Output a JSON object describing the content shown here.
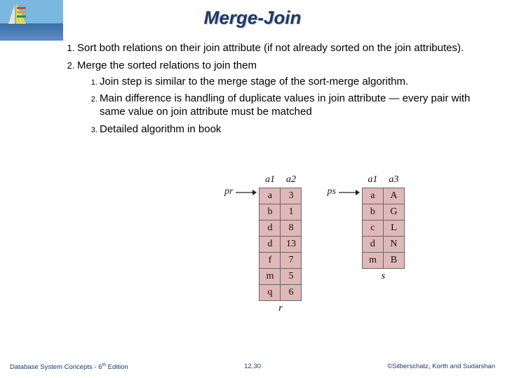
{
  "title": "Merge-Join",
  "bullets": {
    "b1": "Sort both relations on their join attribute (if not already sorted on the join attributes).",
    "b2": "Merge the sorted relations to join them",
    "b2_1": "Join step is similar to the merge stage of the sort-merge algorithm.",
    "b2_2": "Main difference is handling of duplicate values in join attribute — every pair with same value on join attribute must be matched",
    "b2_3": "Detailed algorithm in book"
  },
  "figure": {
    "r": {
      "ptr": "pr",
      "headers": [
        "a1",
        "a2"
      ],
      "rows": [
        [
          "a",
          "3"
        ],
        [
          "b",
          "1"
        ],
        [
          "d",
          "8"
        ],
        [
          "d",
          "13"
        ],
        [
          "f",
          "7"
        ],
        [
          "m",
          "5"
        ],
        [
          "q",
          "6"
        ]
      ],
      "name": "r"
    },
    "s": {
      "ptr": "ps",
      "headers": [
        "a1",
        "a3"
      ],
      "rows": [
        [
          "a",
          "A"
        ],
        [
          "b",
          "G"
        ],
        [
          "c",
          "L"
        ],
        [
          "d",
          "N"
        ],
        [
          "m",
          "B"
        ]
      ],
      "name": "s"
    }
  },
  "footer": {
    "left_a": "Database System Concepts - 6",
    "left_b": " Edition",
    "sup": "th",
    "mid": "12.30",
    "right": "©Silberschatz, Korth and Sudarshan"
  }
}
